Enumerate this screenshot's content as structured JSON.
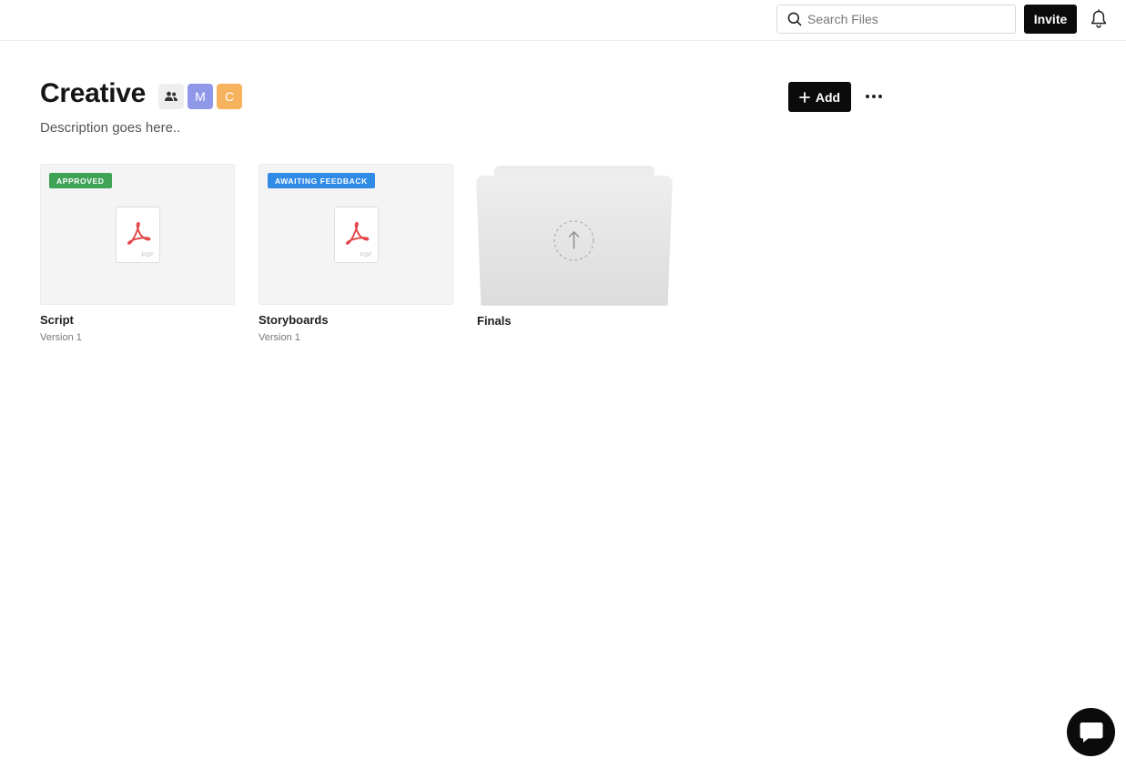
{
  "header": {
    "search": {
      "placeholder": "Search Files",
      "value": ""
    },
    "invite_label": "Invite"
  },
  "project": {
    "title": "Creative",
    "description": "Description goes here..",
    "members": [
      "M",
      "C"
    ],
    "add_label": "Add"
  },
  "files": [
    {
      "name": "Script",
      "version": "Version 1",
      "status": "APPROVED",
      "status_color": "#3fa356",
      "type_label": "PDF"
    },
    {
      "name": "Storyboards",
      "version": "Version 1",
      "status": "AWAITING FEEDBACK",
      "status_color": "#2f8be6",
      "type_label": "PDF"
    }
  ],
  "folders": [
    {
      "name": "Finals"
    }
  ],
  "colors": {
    "accent": "#0b0b0b",
    "member_m": "#8e97e8",
    "member_c": "#f6b25c",
    "pdf_red": "#e2464a"
  },
  "icons": [
    "search-icon",
    "bell-icon",
    "people-icon",
    "plus-icon",
    "more-icon",
    "pdf-icon",
    "upload-icon",
    "chat-icon"
  ]
}
